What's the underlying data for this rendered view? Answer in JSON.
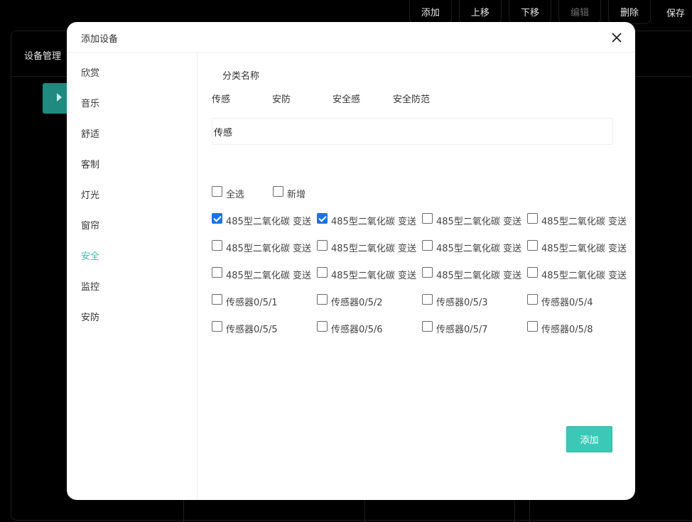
{
  "toolbar": {
    "buttons": [
      {
        "label": "添加",
        "disabled": false
      },
      {
        "label": "上移",
        "disabled": false
      },
      {
        "label": "下移",
        "disabled": false
      },
      {
        "label": "编辑",
        "disabled": true
      },
      {
        "label": "删除",
        "disabled": false
      },
      {
        "label": "保存",
        "disabled": false
      }
    ]
  },
  "background": {
    "title": "设备管理"
  },
  "modal": {
    "title": "添加设备",
    "sidebar": {
      "items": [
        "欣赏",
        "音乐",
        "舒适",
        "客制",
        "灯光",
        "窗帘",
        "安全",
        "监控",
        "安防"
      ],
      "active": "安全"
    },
    "category": {
      "label": "分类名称",
      "tabs": [
        "传感",
        "安防",
        "安全感",
        "安全防范"
      ]
    },
    "name_input": {
      "value": "传感"
    },
    "options": {
      "select_all": {
        "label": "全选",
        "checked": false
      },
      "add_new": {
        "label": "新增",
        "checked": false
      }
    },
    "devices": [
      {
        "label": "485型二氧化碳 变送",
        "checked": true
      },
      {
        "label": "485型二氧化碳 变送",
        "checked": true
      },
      {
        "label": "485型二氧化碳 变送",
        "checked": false
      },
      {
        "label": "485型二氧化碳 变送",
        "checked": false
      },
      {
        "label": "485型二氧化碳 变送",
        "checked": false
      },
      {
        "label": "485型二氧化碳 变送",
        "checked": false
      },
      {
        "label": "485型二氧化碳 变送",
        "checked": false
      },
      {
        "label": "485型二氧化碳 变送",
        "checked": false
      },
      {
        "label": "485型二氧化碳 变送",
        "checked": false
      },
      {
        "label": "485型二氧化碳 变送",
        "checked": false
      },
      {
        "label": "485型二氧化碳 变送",
        "checked": false
      },
      {
        "label": "485型二氧化碳 变送",
        "checked": false
      },
      {
        "label": "传感器0/5/1",
        "checked": false
      },
      {
        "label": "传感器0/5/2",
        "checked": false
      },
      {
        "label": "传感器0/5/3",
        "checked": false
      },
      {
        "label": "传感器0/5/4",
        "checked": false
      },
      {
        "label": "传感器0/5/5",
        "checked": false
      },
      {
        "label": "传感器0/5/6",
        "checked": false
      },
      {
        "label": "传感器0/5/7",
        "checked": false
      },
      {
        "label": "传感器0/5/8",
        "checked": false
      }
    ],
    "submit_label": "添加",
    "colors": {
      "accent": "#3cc8b7",
      "active_text": "#3cbfae",
      "checkbox_checked": "#1a73e8"
    }
  }
}
